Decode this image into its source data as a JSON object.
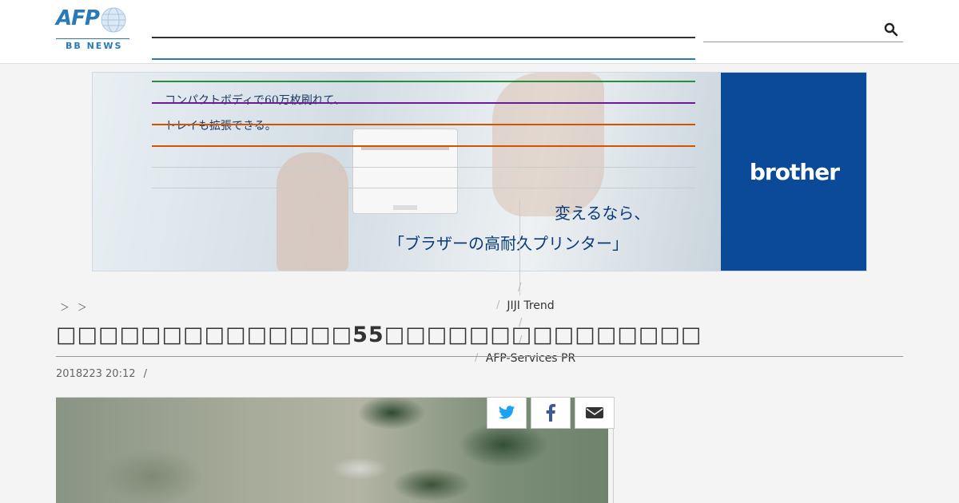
{
  "header": {
    "logo_text": "AFP",
    "logo_sub": "BB NEWS",
    "search_placeholder": ""
  },
  "ad": {
    "copy_line1": "コンパクトボディで60万枚刷れて、",
    "copy_line2": "トレイも拡張できる。",
    "tagline1": "変えるなら、",
    "tagline2": "「ブラザーの高耐久プリンター」",
    "brand": "brother",
    "brand_color": "#0b4a98"
  },
  "breadcrumb": {
    "separator1": "＞",
    "separator2": "＞"
  },
  "menu": {
    "items": [
      "JIJI Trend",
      "AFP-Services PR"
    ],
    "slash": "/"
  },
  "article": {
    "title": "□□□□□□□□□□□□□□55□□□□□□□□□□□□□□□",
    "date": "2018223 20:12",
    "date_sep": "/"
  },
  "share": {
    "icons": [
      "twitter-icon",
      "facebook-icon",
      "email-icon"
    ],
    "twitter_color": "#1da1f2",
    "facebook_color": "#3b5998",
    "email_color": "#333333"
  },
  "colors": {
    "accent": "#2a7ab9",
    "nav_line_green": "#2e8b3d",
    "nav_line_purple": "#6a1b9a",
    "nav_line_orange": "#d35400"
  }
}
